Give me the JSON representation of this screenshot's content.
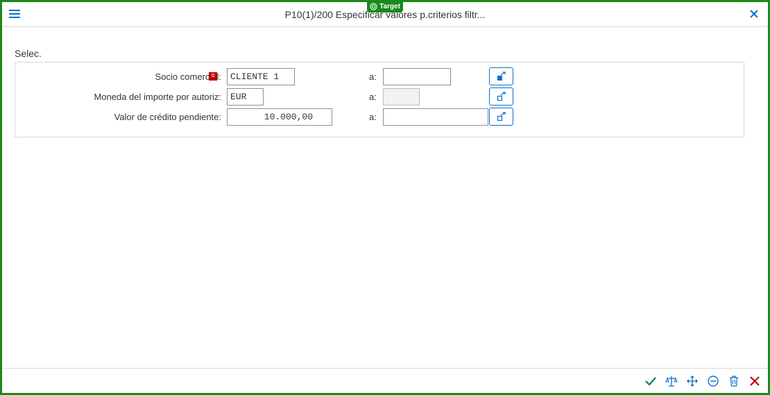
{
  "badge": {
    "label": "Target"
  },
  "window": {
    "title": "P10(1)/200 Especificar valores p.criterios filtr..."
  },
  "section": {
    "label": "Selec."
  },
  "rows": [
    {
      "label": "Socio comercial:",
      "from_value": "CLIENTE 1",
      "to_label": "a:",
      "to_value": ""
    },
    {
      "label": "Moneda del importe por autoriz:",
      "from_value": "EUR",
      "to_label": "a:",
      "to_value": ""
    },
    {
      "label": "Valor de crédito pendiente:",
      "from_value": "10.000,00",
      "to_label": "a:",
      "to_value": ""
    }
  ],
  "option_icon": {
    "text": "="
  },
  "colors": {
    "accent": "#0a6ed1",
    "frame": "#1a8a1a",
    "accept": "#107e3e",
    "cancel": "#bb0000"
  }
}
